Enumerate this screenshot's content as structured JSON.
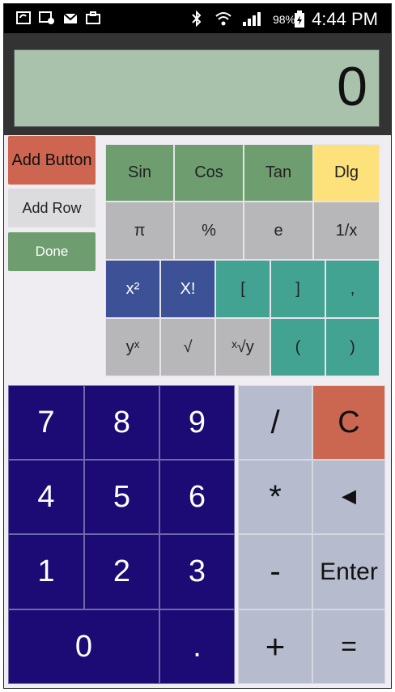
{
  "status": {
    "battery_percent": "98%",
    "time": "4:44 PM",
    "icons": [
      "sync-icon",
      "picture-icon",
      "mail-icon",
      "briefcase-icon",
      "bluetooth-icon",
      "wifi-icon",
      "signal-icon",
      "battery-icon"
    ]
  },
  "display": {
    "value": "0"
  },
  "side_buttons": {
    "add_button": "Add Button",
    "add_row": "Add Row",
    "done": "Done"
  },
  "functions": {
    "row1": [
      "Sin",
      "Cos",
      "Tan",
      "Dlg"
    ],
    "row2": [
      "π",
      "%",
      "e",
      "1/x"
    ],
    "row3": [
      "x²",
      "X!",
      "[",
      "]",
      ","
    ],
    "row4": [
      "yˣ",
      "√",
      "ˣ√y",
      "(",
      ")"
    ]
  },
  "keypad": {
    "digits": [
      "7",
      "8",
      "9",
      "4",
      "5",
      "6",
      "1",
      "2",
      "3",
      "0",
      "."
    ],
    "operators": [
      "/",
      "*",
      "-",
      "+"
    ],
    "clear": "C",
    "backspace": "◄",
    "enter": "Enter",
    "equals": "="
  },
  "colors": {
    "green": "#6e9e6f",
    "yellow": "#fde17a",
    "grey": "#b7b7b9",
    "blue": "#3c5196",
    "teal": "#42a393",
    "navy": "#1c0b74",
    "op_grey": "#b6bccd",
    "clear_red": "#cb6750",
    "add_button_red": "#cd6550"
  }
}
